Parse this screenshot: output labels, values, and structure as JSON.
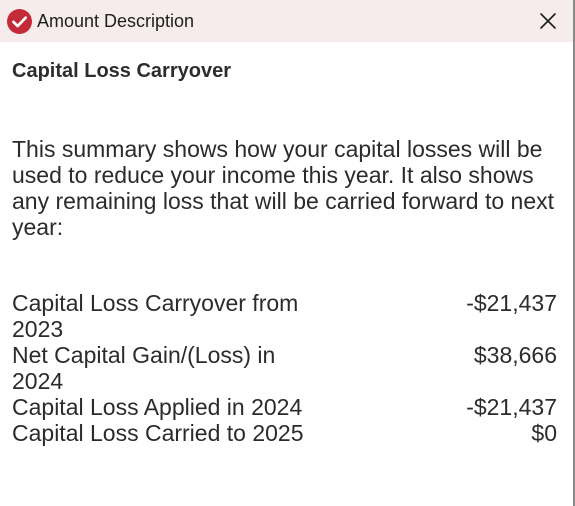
{
  "window": {
    "title": "Amount Description",
    "icon": "check-circle-icon",
    "accent_color": "#c42b38",
    "titlebar_color": "#f7ecec"
  },
  "heading": "Capital Loss Carryover",
  "intro": "This summary shows how your capital losses will be used to reduce your income this year. It also shows any remaining loss that will be carried forward to next year:",
  "rows": [
    {
      "label": "Capital Loss Carryover from 2023",
      "value": "-$21,437"
    },
    {
      "label": "Net Capital Gain/(Loss) in 2024",
      "value": "$38,666"
    },
    {
      "label": "Capital Loss Applied in 2024",
      "value": "-$21,437"
    },
    {
      "label": "Capital Loss Carried to 2025",
      "value": "$0"
    }
  ]
}
